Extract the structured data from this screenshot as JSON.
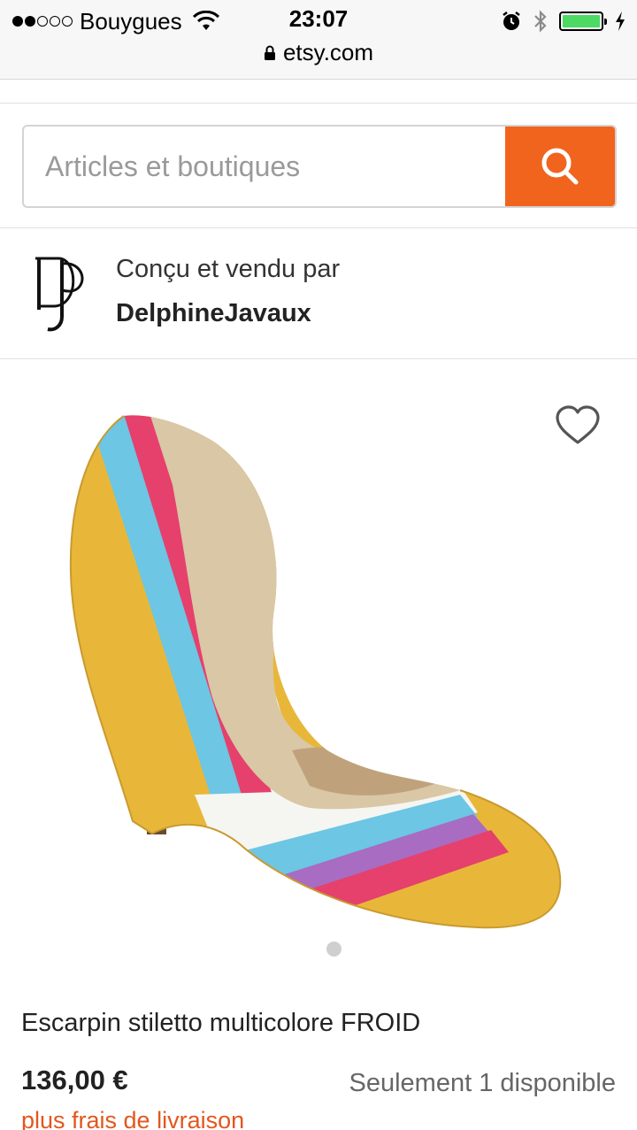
{
  "status_bar": {
    "carrier": "Bouygues",
    "time": "23:07",
    "url": "etsy.com",
    "signal_bars_filled": 2,
    "signal_bars_total": 5,
    "battery_level": 1.0
  },
  "search": {
    "placeholder": "Articles et boutiques",
    "button_icon": "search-icon",
    "button_color": "#f1641e"
  },
  "seller": {
    "caption": "Conçu et vendu par",
    "name": "DelphineJavaux",
    "logo_icon": "dj-monogram-logo"
  },
  "product": {
    "image_icon": "multicolor-stiletto-pump-image",
    "favorite_icon": "heart-icon",
    "carousel_page": 1,
    "title": "Escarpin stiletto multicolore FROID",
    "price": "136,00 €",
    "availability": "Seulement 1 disponible",
    "shipping_link": "plus frais de livraison"
  },
  "colors": {
    "accent": "#f1641e",
    "link": "#e2571e",
    "shoe_yellow": "#e8b73a",
    "shoe_blue": "#6cc6e4",
    "shoe_pink": "#e6406c",
    "shoe_purple": "#a86cc2"
  }
}
